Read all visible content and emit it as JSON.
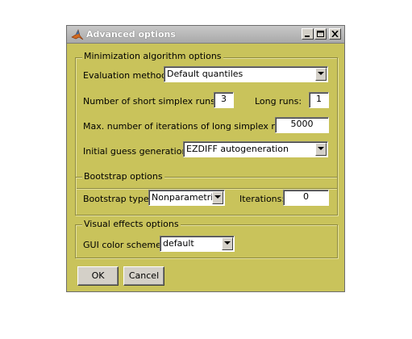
{
  "window": {
    "title": "Advanced options",
    "icon": "matlab-icon"
  },
  "title_buttons": {
    "minimize": "minimize-icon",
    "maximize": "maximize-icon",
    "close": "close-icon"
  },
  "minimization": {
    "legend": "Minimization algorithm options",
    "eval_label": "Evaluation method:",
    "eval_value": "Default quantiles",
    "short_runs_label": "Number of short simplex runs:",
    "short_runs_value": "3",
    "long_runs_label": "Long runs:",
    "long_runs_value": "1",
    "max_iter_label": "Max. number of iterations of long simplex runs:",
    "max_iter_value": "5000",
    "guess_label": "Initial guess generation:",
    "guess_value": "EZDIFF autogeneration"
  },
  "bootstrap": {
    "legend": "Bootstrap options",
    "type_label": "Bootstrap type:",
    "type_value": "Nonparametric",
    "iter_label": "Iterations:",
    "iter_value": "0"
  },
  "visual": {
    "legend": "Visual effects options",
    "scheme_label": "GUI color scheme:",
    "scheme_value": "default"
  },
  "buttons": {
    "ok": "OK",
    "cancel": "Cancel"
  },
  "colors": {
    "dialog_bg": "#c9c35b",
    "title_bg": "#a9a9a9"
  }
}
